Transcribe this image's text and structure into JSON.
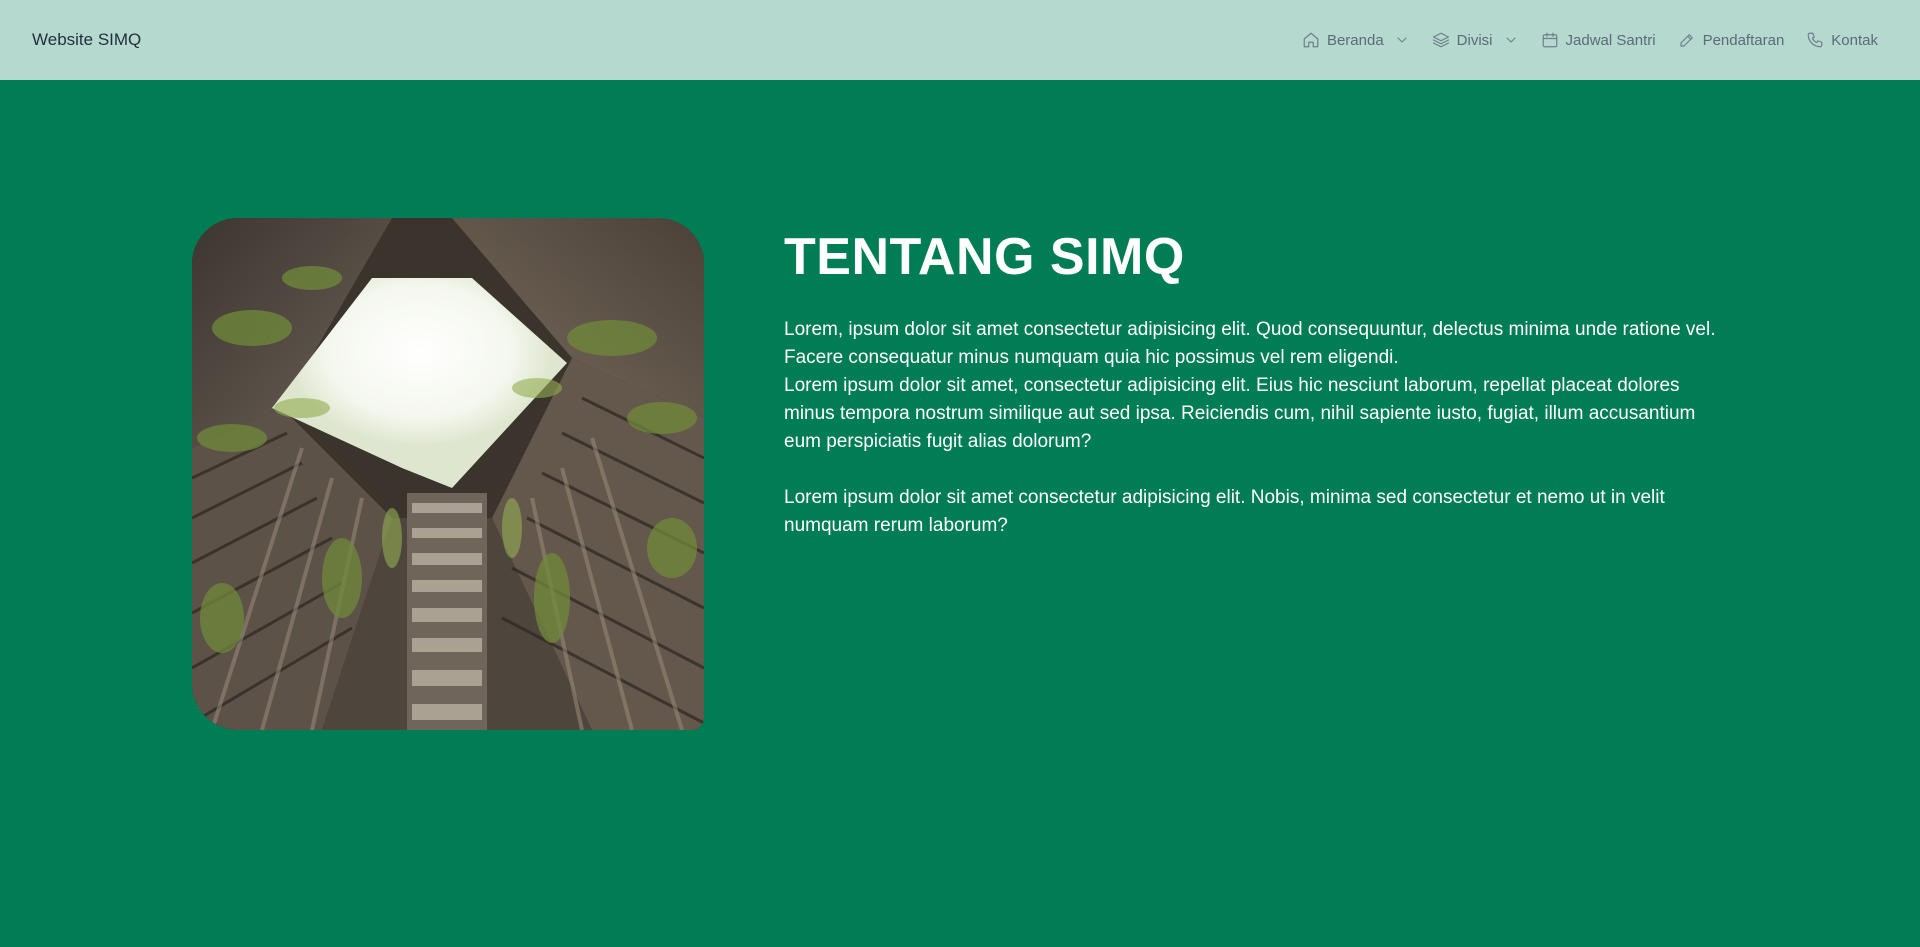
{
  "brand": "Website SIMQ",
  "nav": {
    "items": [
      {
        "label": "Beranda",
        "icon": "home-icon",
        "has_dropdown": true
      },
      {
        "label": "Divisi",
        "icon": "layers-icon",
        "has_dropdown": true
      },
      {
        "label": "Jadwal Santri",
        "icon": "calendar-icon",
        "has_dropdown": false
      },
      {
        "label": "Pendaftaran",
        "icon": "pencil-icon",
        "has_dropdown": false
      },
      {
        "label": "Kontak",
        "icon": "phone-icon",
        "has_dropdown": false
      }
    ]
  },
  "about": {
    "title": "TENTANG SIMQ",
    "paragraph1_line1": "Lorem, ipsum dolor sit amet consectetur adipisicing elit. Quod consequuntur, delectus minima unde ratione vel. Facere consequatur minus numquam quia hic possimus vel rem eligendi.",
    "paragraph1_line2": "Lorem ipsum dolor sit amet, consectetur adipisicing elit. Eius hic nesciunt laborum, repellat placeat dolores minus tempora nostrum similique aut sed ipsa. Reiciendis cum, nihil sapiente iusto, fugiat, illum accusantium eum perspiciatis fugit alias dolorum?",
    "paragraph2": "Lorem ipsum dolor sit amet consectetur adipisicing elit. Nobis, minima sed consectetur et nemo ut in velit numquam rerum laborum?"
  },
  "colors": {
    "navbar_bg": "#b5d8cf",
    "page_bg": "#007d55",
    "text_light": "#ffffff",
    "nav_text": "#5a6b78"
  }
}
